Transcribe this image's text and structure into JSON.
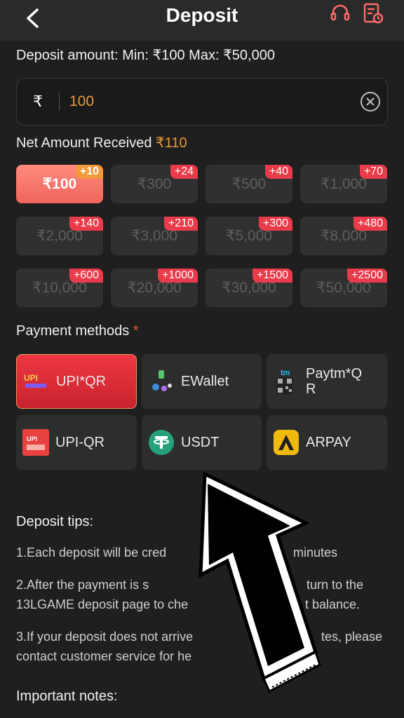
{
  "header": {
    "title": "Deposit"
  },
  "deposit": {
    "label": "Deposit amount: Min: ₹100 Max: ₹50,000",
    "currency_symbol": "₹",
    "value": "100",
    "net_label": "Net Amount Received",
    "net_value": "₹110"
  },
  "amounts": [
    {
      "label": "₹100",
      "bonus": "+10"
    },
    {
      "label": "₹300",
      "bonus": "+24"
    },
    {
      "label": "₹500",
      "bonus": "+40"
    },
    {
      "label": "₹1,000",
      "bonus": "+70"
    },
    {
      "label": "₹2,000",
      "bonus": "+140"
    },
    {
      "label": "₹3,000",
      "bonus": "+210"
    },
    {
      "label": "₹5,000",
      "bonus": "+300"
    },
    {
      "label": "₹8,000",
      "bonus": "+480"
    },
    {
      "label": "₹10,000",
      "bonus": "+600"
    },
    {
      "label": "₹20,000",
      "bonus": "+1000"
    },
    {
      "label": "₹30,000",
      "bonus": "+1500"
    },
    {
      "label": "₹50,000",
      "bonus": "+2500"
    }
  ],
  "payment": {
    "label": "Payment methods",
    "required_mark": "*",
    "methods": [
      {
        "label": "UPI*QR",
        "icon": "upi-qr-logo-icon"
      },
      {
        "label": "EWallet",
        "icon": "ewallet-icon"
      },
      {
        "label": "Paytm*Q\nR",
        "icon": "paytm-qr-icon"
      },
      {
        "label": "UPI-QR",
        "icon": "upi-qr-icon"
      },
      {
        "label": "USDT",
        "icon": "tether-icon"
      },
      {
        "label": "ARPAY",
        "icon": "arpay-icon"
      }
    ]
  },
  "tips": {
    "title": "Deposit tips:",
    "items": [
      "1.Each deposit will be cred",
      "minutes",
      "2.After the payment is s",
      "turn to the",
      "13LGAME deposit page to che",
      "t balance.",
      "3.If your deposit does not arrive",
      "tes, please",
      "contact customer service for he"
    ]
  },
  "notes": {
    "title": "Important notes:"
  },
  "colors": {
    "accent": "#e79a3c",
    "active_red": "#ea3b4a",
    "bg": "#1f1f1f"
  }
}
